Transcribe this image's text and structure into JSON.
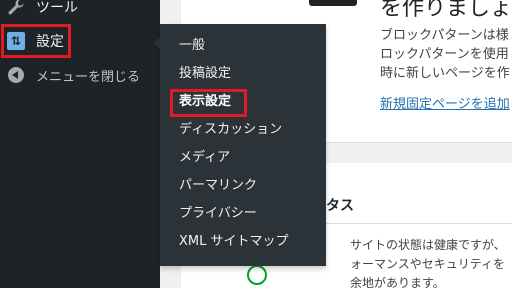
{
  "sidebar": {
    "items": [
      {
        "id": "tools",
        "label": "ツール",
        "icon": "wrench-icon"
      },
      {
        "id": "settings",
        "label": "設定",
        "icon": "settings-icon",
        "icon_glyph": "⇅",
        "active": true
      },
      {
        "id": "collapse",
        "label": "メニューを閉じる",
        "icon": "collapse-arrow-icon"
      }
    ]
  },
  "flyout": {
    "items": [
      {
        "label": "一般"
      },
      {
        "label": "投稿設定"
      },
      {
        "label": "表示設定",
        "selected": true
      },
      {
        "label": "ディスカッション"
      },
      {
        "label": "メディア"
      },
      {
        "label": "パーマリンク"
      },
      {
        "label": "プライバシー"
      },
      {
        "label": "XML サイトマップ"
      }
    ]
  },
  "main": {
    "card1": {
      "heading": "を作りましょう",
      "lines": [
        "ブロックパターンは様",
        "ロックパターンを使用",
        "時に新しいページを作"
      ],
      "link": "新規固定ページを追加"
    },
    "card2": {
      "heading": "タス",
      "lines": [
        "サイトの状態は健康ですが、",
        "ォーマンスやセキュリティを",
        "余地があります。"
      ]
    }
  },
  "colors": {
    "sidebar_bg": "#1d2327",
    "flyout_bg": "#2c3338",
    "accent_blue": "#72aee6",
    "highlight_red": "#e01b24",
    "link_blue": "#2271b1",
    "status_green": "#00a32a"
  }
}
